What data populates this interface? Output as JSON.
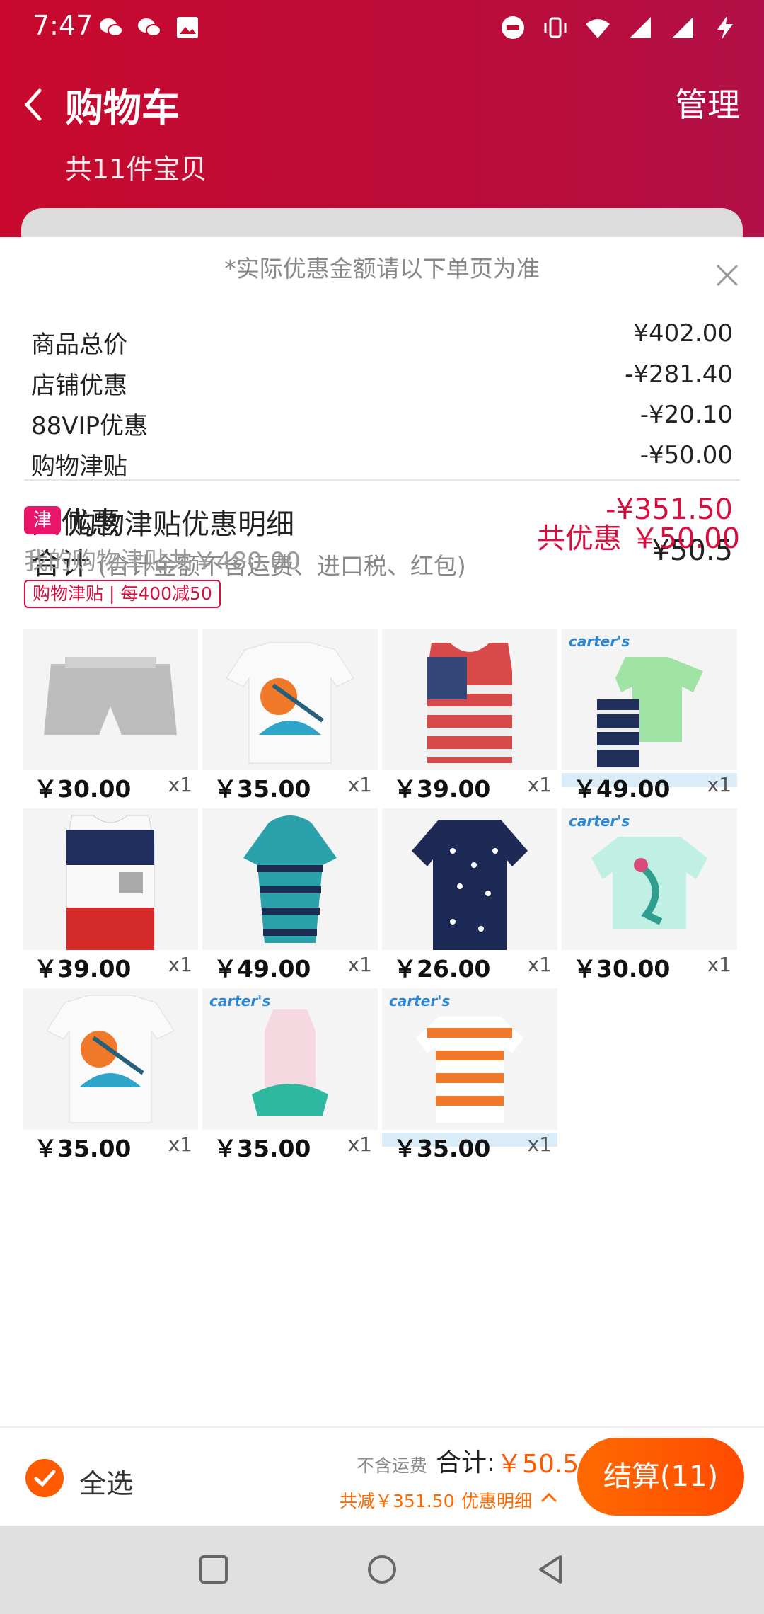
{
  "status_bar": {
    "time": "7:47"
  },
  "header": {
    "title": "购物车",
    "manage": "管理",
    "count": "共11件宝贝"
  },
  "sheet": {
    "note": "*实际优惠金额请以下单页为准",
    "rows": [
      {
        "label": "商品总价",
        "value": "¥402.00"
      },
      {
        "label": "店铺优惠",
        "value": "-¥281.40"
      },
      {
        "label": "88VIP优惠",
        "value": "-¥20.10"
      },
      {
        "label": "购物津贴",
        "value": "-¥50.00"
      }
    ],
    "total_discount": {
      "label": "共优惠",
      "value": "-¥351.50"
    },
    "subtotal": {
      "label": "合计",
      "sub": "(合计金额不含运费、进口税、红包)",
      "value": "¥50.5"
    }
  },
  "subsidy": {
    "icon_text": "津",
    "title": "购物津贴优惠明细",
    "total": "共优惠 ￥50.00",
    "mine": "我的购物津贴共￥480.00",
    "rule": "购物津贴 | 每400减50"
  },
  "items": [
    {
      "price": "￥30.00",
      "qty": "x1",
      "icon": "gray-shorts-image",
      "brand": ""
    },
    {
      "price": "￥35.00",
      "qty": "x1",
      "icon": "marlin-tshirt-image",
      "brand": ""
    },
    {
      "price": "￥39.00",
      "qty": "x1",
      "icon": "flag-tank-image",
      "brand": ""
    },
    {
      "price": "￥49.00",
      "qty": "x1",
      "icon": "bodysuit-pants-set-image",
      "brand": "carter's"
    },
    {
      "price": "￥39.00",
      "qty": "x1",
      "icon": "colorblock-tank-image",
      "brand": ""
    },
    {
      "price": "￥49.00",
      "qty": "x1",
      "icon": "striped-hoodie-romper-image",
      "brand": ""
    },
    {
      "price": "￥26.00",
      "qty": "x1",
      "icon": "polka-dot-romper-image",
      "brand": ""
    },
    {
      "price": "￥30.00",
      "qty": "x1",
      "icon": "mermaid-bodysuit-image",
      "brand": "carter's"
    },
    {
      "price": "￥35.00",
      "qty": "x1",
      "icon": "marlin-tshirt-image",
      "brand": ""
    },
    {
      "price": "￥35.00",
      "qty": "x1",
      "icon": "tutu-bodysuit-image",
      "brand": "carter's"
    },
    {
      "price": "￥35.00",
      "qty": "x1",
      "icon": "striped-romper-image",
      "brand": "carter's"
    }
  ],
  "bottom_bar": {
    "select_all": "全选",
    "shipping_note": "不含运费",
    "total_label": "合计:",
    "total_value": "￥50.5",
    "discount": "共减￥351.50",
    "detail": "优惠明细",
    "checkout": "结算(11)"
  },
  "colors": {
    "header_red": "#c8092d",
    "accent_orange": "#ff5a00",
    "discount_red": "#d80f3e"
  }
}
